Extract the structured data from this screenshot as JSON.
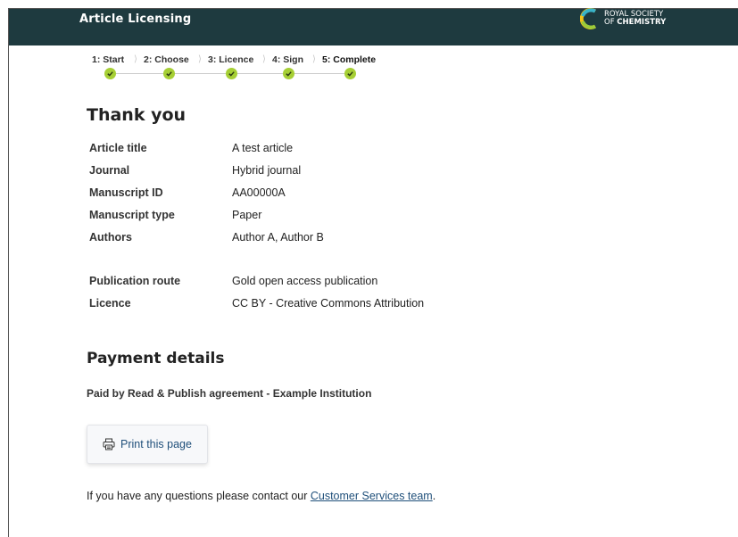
{
  "header": {
    "app_title": "Article Licensing",
    "logo_line1": "ROYAL SOCIETY",
    "logo_line2_prefix": "OF ",
    "logo_line2_bold": "CHEMISTRY",
    "logo_icon": "rsc-logo-icon",
    "bg_color": "#1e3a3f"
  },
  "steps": [
    {
      "label": "1: Start",
      "done": true
    },
    {
      "label": "2: Choose",
      "done": true
    },
    {
      "label": "3: Licence",
      "done": true
    },
    {
      "label": "4: Sign",
      "done": true
    },
    {
      "label": "5: Complete",
      "done": true,
      "active": true
    }
  ],
  "check_color": "#a6cf35",
  "thank_you": {
    "heading": "Thank you",
    "details": [
      {
        "key": "Article title",
        "value": "A test article"
      },
      {
        "key": "Journal",
        "value": "Hybrid journal"
      },
      {
        "key": "Manuscript ID",
        "value": "AA00000A"
      },
      {
        "key": "Manuscript type",
        "value": "Paper"
      },
      {
        "key": "Authors",
        "value": "Author A, Author B"
      }
    ],
    "publication": [
      {
        "key": "Publication route",
        "value": "Gold open access publication"
      },
      {
        "key": "Licence",
        "value": "CC BY - Creative Commons Attribution"
      }
    ]
  },
  "payment": {
    "heading": "Payment details",
    "text": "Paid by Read & Publish agreement - Example Institution"
  },
  "print_button": {
    "label": "Print this page",
    "icon": "printer-icon"
  },
  "footer": {
    "prefix": "If you have any questions please contact our ",
    "link_text": "Customer Services team",
    "suffix": "."
  }
}
